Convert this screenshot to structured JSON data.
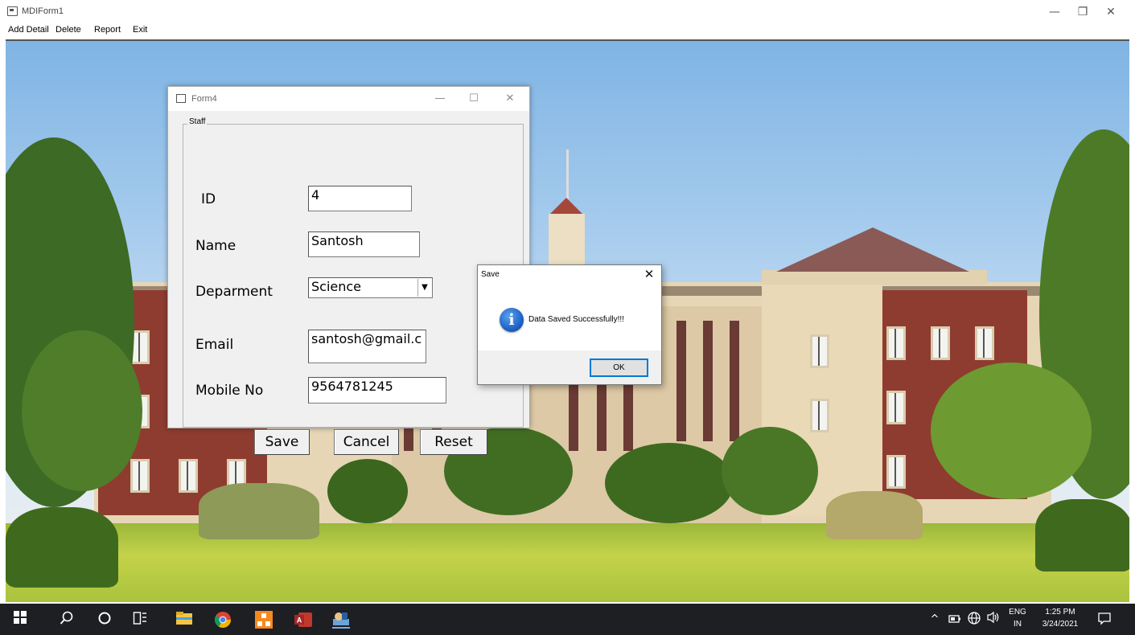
{
  "mdi": {
    "title": "MDIForm1",
    "menu": [
      "Add Detail",
      "Delete",
      "Report",
      "Exit"
    ],
    "controls": {
      "minimize": "—",
      "restore": "❐",
      "close": "✕"
    }
  },
  "form4": {
    "title": "Form4",
    "controls": {
      "minimize": "—",
      "maximize": "☐",
      "close": "✕"
    },
    "group_label": "Staff",
    "fields": {
      "id": {
        "label": "ID",
        "value": "4"
      },
      "name": {
        "label": "Name",
        "value": "Santosh"
      },
      "department": {
        "label": "Deparment",
        "value": "Science"
      },
      "email": {
        "label": "Email",
        "value": "santosh@gmail.c"
      },
      "mobile": {
        "label": "Mobile No",
        "value": "9564781245"
      }
    },
    "buttons": {
      "save": "Save",
      "cancel": "Cancel",
      "reset": "Reset"
    }
  },
  "msgbox": {
    "title": "Save",
    "message": "Data Saved Successfully!!!",
    "ok": "OK",
    "icon": "information-icon"
  },
  "taskbar": {
    "language": "ENG",
    "region": "IN",
    "time": "1:25 PM",
    "date": "3/24/2021"
  }
}
